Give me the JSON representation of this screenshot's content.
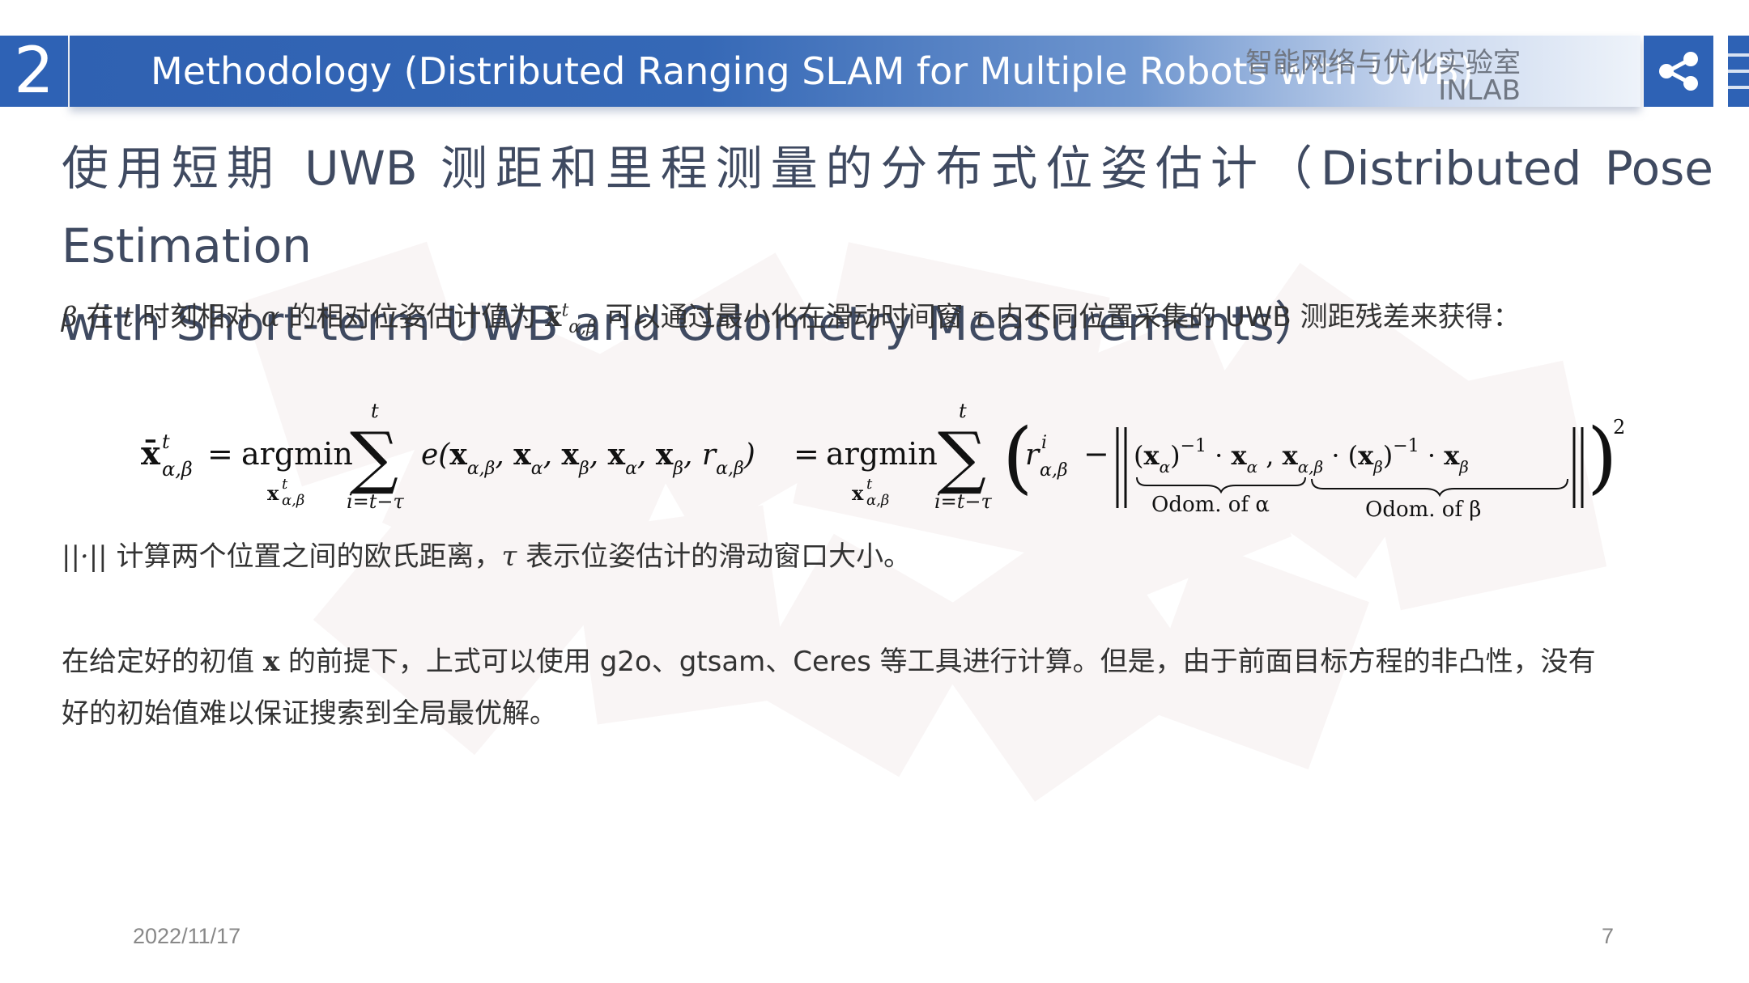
{
  "header": {
    "section_number": "2",
    "title": "Methodology (Distributed Ranging SLAM for Multiple Robots with UWB)",
    "lab_name_cn": "智能网络与优化实验室",
    "lab_name_en": "INLAB"
  },
  "icons": {
    "share": "share-icon"
  },
  "colors": {
    "primary": "#2e62b5",
    "heading": "#3f4a61",
    "text": "#333333"
  },
  "heading": {
    "line1": "使用短期 UWB 测距和里程测量的分布式位姿估计（Distributed Pose Estimation",
    "line2": "with Short-term UWB and Odometry Measurements）"
  },
  "para1": {
    "beta": "β",
    "t1": " 在 ",
    "t": "t",
    "t2": " 时刻相对 ",
    "alpha": "α",
    "t3": " 的相对位姿估计值为 ",
    "x": "x̄",
    "sup": "t",
    "sub": "α,β",
    "t4": " 可以通过最小化在滑动时间窗 ",
    "tau": "τ",
    "t5": " 内不同位置采集的 UWB 测距残差来获得："
  },
  "formula": {
    "lhs": "x̄",
    "lhs_sup": "t",
    "lhs_sub": "α,β",
    "eq": "=",
    "argmin": "argmin",
    "argmin_sub_x": "x",
    "argmin_sub_sup": "t",
    "argmin_sub_sub": "α,β",
    "sum_top": "t",
    "sum_bottom": "i=t−τ",
    "e_args": "e(x",
    "e_rest": "x, x, x, x, r)",
    "r": "r",
    "r_sup": "i",
    "r_sub": "α,β",
    "minus": "−",
    "odom_alpha": "Odom. of α",
    "odom_beta": "Odom. of β",
    "power": "2"
  },
  "para2": {
    "norm": "||·||",
    "t1": " 计算两个位置之间的欧氏距离，",
    "tau": "τ",
    "t2": " 表示位姿估计的滑动窗口大小。"
  },
  "para3": {
    "t1": "在给定好的初值 ",
    "x": "x",
    "t2": " 的前提下，上式可以使用 g2o、gtsam、Ceres 等工具进行计算。但是，由于前面目标方程的非凸性，没有",
    "line2": "好的初始值难以保证搜索到全局最优解。"
  },
  "footer": {
    "date": "2022/11/17",
    "page": "7"
  }
}
